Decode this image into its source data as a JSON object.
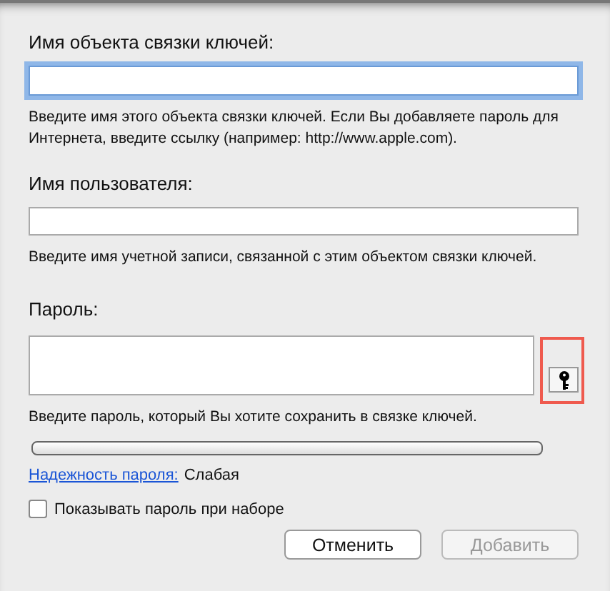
{
  "fields": [
    {
      "kind": "text",
      "label": "Имя объекта связки ключей:",
      "focused": true,
      "help": "Введите имя этого объекта связки ключей. Если Вы добавляете пароль для Интернета, введите ссылку (например: http://www.apple.com)."
    },
    {
      "kind": "text",
      "label": "Имя пользователя:",
      "focused": false,
      "help": "Введите имя учетной записи, связанной с этим объектом связки ключей."
    },
    {
      "kind": "password",
      "label": "Пароль:",
      "focused": false,
      "help": "Введите пароль, который Вы хотите сохранить в связке ключей.",
      "key_button_highlighted": true
    }
  ],
  "strength": {
    "level": 0,
    "link": "Надежность пароля:",
    "value": "Слабая"
  },
  "show_password": {
    "label": "Показывать пароль при наборе",
    "checked": false
  },
  "buttons": [
    {
      "label": "Отменить",
      "disabled": false
    },
    {
      "label": "Добавить",
      "disabled": true
    }
  ]
}
